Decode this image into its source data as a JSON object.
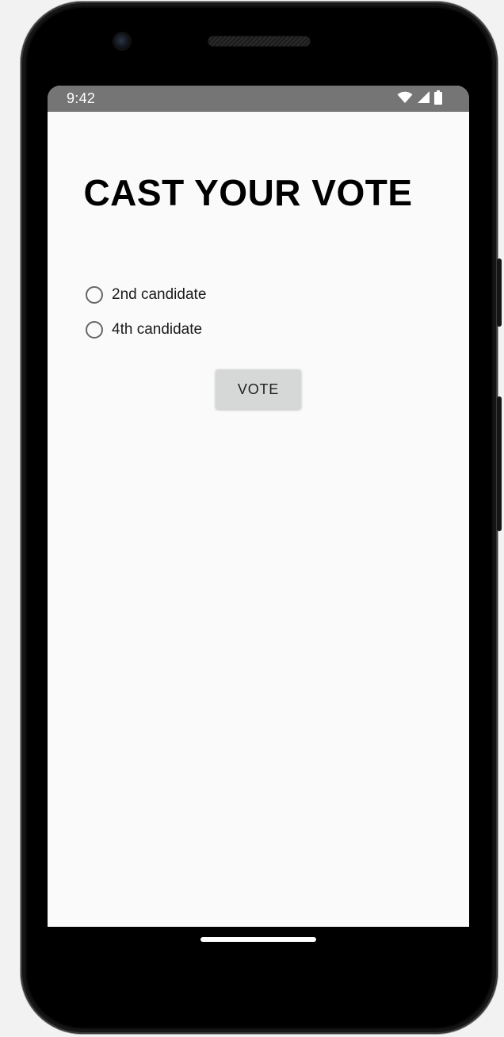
{
  "status_bar": {
    "time": "9:42",
    "icons": [
      "wifi-icon",
      "cellular-signal-icon",
      "battery-icon"
    ]
  },
  "main": {
    "title": "CAST YOUR VOTE",
    "radio_options": [
      {
        "label": "2nd candidate",
        "selected": false
      },
      {
        "label": "4th candidate",
        "selected": false
      }
    ],
    "vote_button_label": "VOTE"
  },
  "colors": {
    "status_bar_bg": "#757575",
    "screen_bg": "#fafafa",
    "button_bg": "#d6d7d7",
    "radio_outline": "#666666"
  }
}
